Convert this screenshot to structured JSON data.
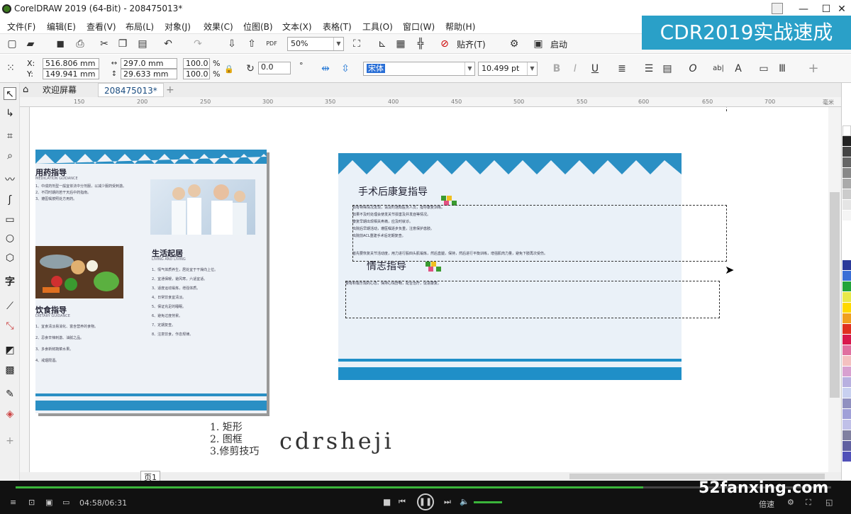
{
  "window": {
    "title": "CorelDRAW 2019 (64-Bit) - 208475013*",
    "min": "—",
    "restore": "☐",
    "close": "✕"
  },
  "menu": [
    "文件(F)",
    "编辑(E)",
    "查看(V)",
    "布局(L)",
    "对象(J)",
    "效果(C)",
    "位图(B)",
    "文本(X)",
    "表格(T)",
    "工具(O)",
    "窗口(W)",
    "帮助(H)"
  ],
  "brand": "CDR2019实战速成",
  "toolbar": {
    "zoom": "50%",
    "snap_label": "贴齐(T)",
    "launch_label": "启动",
    "pdf": "PDF"
  },
  "props": {
    "x_label": "X:",
    "y_label": "Y:",
    "x": "516.806 mm",
    "y": "149.941 mm",
    "w": "297.0 mm",
    "h": "29.633 mm",
    "sx": "100.0",
    "sy": "100.0",
    "pct": "%",
    "rot": "0.0",
    "deg": "°",
    "font": "宋体",
    "size": "10.499 pt",
    "bold": "B",
    "italic": "I",
    "under": "U",
    "abl": "ab|",
    "add": "+"
  },
  "tabs": {
    "home": "欢迎屏幕",
    "doc": "208475013*",
    "plus": "+"
  },
  "ruler": [
    "150",
    "200",
    "250",
    "300",
    "350",
    "400",
    "450",
    "500",
    "550",
    "600",
    "650",
    "700",
    "毫米"
  ],
  "brochure_left": {
    "med_title": "用药指导",
    "med_sub": "MEDICATION GUIDANCE",
    "med_text": "1、中成药剂型一般宜依法中分剂服，以减少服药受刺激。\n2、不同时期的若干天后中药指南。\n3、遵医嘱按照处方用药。",
    "life_title": "生活起居",
    "life_sub": "LIVING AND LIVING",
    "life_text": "1、情气体质养生，居处宜于干燥向上位。\n2、宜通保暖，避风寒，六适宜适。\n3、适度运动锻炼，增强体质。\n4、日常饮食宜清淡。\n5、保证充足的睡眠。\n6、避免过度劳累。\n7、定期复查。\n8、注意饮食，作息规律。",
    "diet_title": "饮食指导",
    "diet_sub": "DIETARY GUIDANCE",
    "diet_text": "1、宜食清淡易消化、富含营养的食物。\n2、忌食辛辣刺激、油腻之品。\n3、多食新鲜蔬菜水果。\n4、戒烟限酒。"
  },
  "panel": {
    "rehab_title": "手术后康复指导",
    "rehab_text": "如有特殊情况发现，请及时通知医务人员，指导康复训练。\n如果不及时处理会使发关节损害及并发症等情况。\n康复早期出现相关疼痛，应及时就诊。\n出院后早期活动，遵医嘱逐步负重，注意保护患肢。\n出院前ACL重建手术后定期复查。",
    "rehab_last": "首先要恢复关节活动度，用力进行股四头肌锻炼，然后直腿，保持，然后进行平衡训练，增强肌肉力量，避免下肢再次受伤。",
    "emo_title": "情志指导",
    "emo_text": "要有积极乐观的心态，保持心情舒畅，配合治疗，促进康复。"
  },
  "notes": {
    "line1": "1. 矩形",
    "line2": "2. 图框",
    "line3": "3.修剪技巧",
    "handle": "cdrsheji"
  },
  "page_tab": "页1",
  "player": {
    "time": "04:58/06:31",
    "quality": "倍速",
    "watermark": "52fanxing.com"
  },
  "colors": {
    "accent": "#2aa0c8",
    "panel_bg": "#e9f0f8",
    "band": "#1f8fc8"
  }
}
